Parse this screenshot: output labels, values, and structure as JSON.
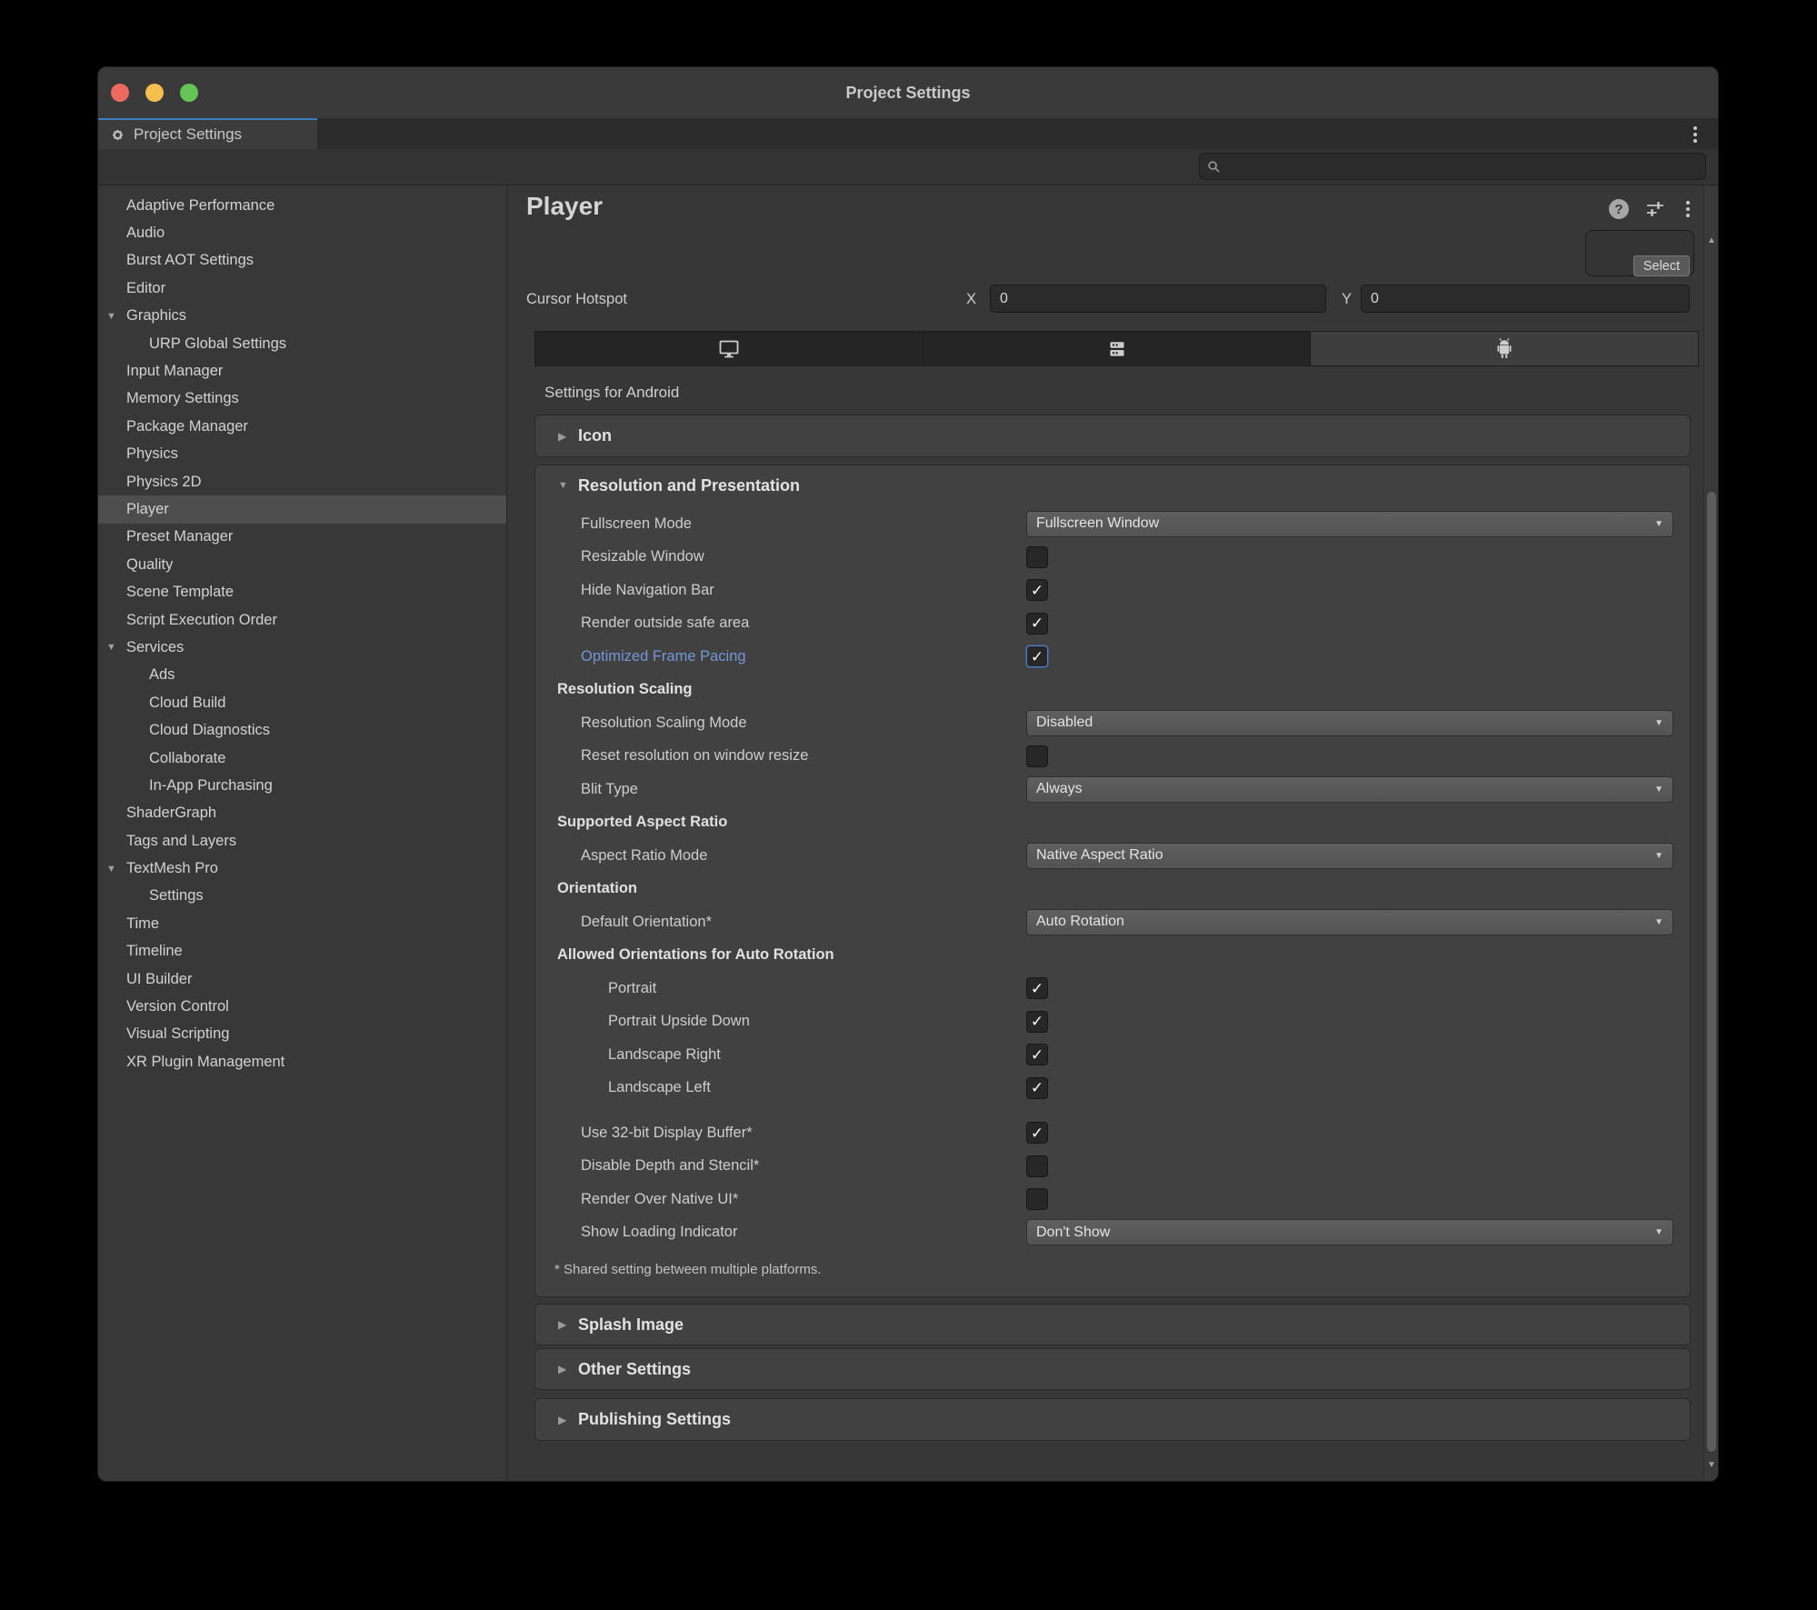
{
  "window": {
    "title": "Project Settings",
    "tab_label": "Project Settings"
  },
  "toolbar": {
    "search_placeholder": ""
  },
  "sidebar": {
    "items": [
      {
        "label": "Adaptive Performance",
        "indent": 0
      },
      {
        "label": "Audio",
        "indent": 0
      },
      {
        "label": "Burst AOT Settings",
        "indent": 0
      },
      {
        "label": "Editor",
        "indent": 0
      },
      {
        "label": "Graphics",
        "indent": 0,
        "expanded": true
      },
      {
        "label": "URP Global Settings",
        "indent": 1
      },
      {
        "label": "Input Manager",
        "indent": 0
      },
      {
        "label": "Memory Settings",
        "indent": 0
      },
      {
        "label": "Package Manager",
        "indent": 0
      },
      {
        "label": "Physics",
        "indent": 0
      },
      {
        "label": "Physics 2D",
        "indent": 0
      },
      {
        "label": "Player",
        "indent": 0,
        "selected": true
      },
      {
        "label": "Preset Manager",
        "indent": 0
      },
      {
        "label": "Quality",
        "indent": 0
      },
      {
        "label": "Scene Template",
        "indent": 0
      },
      {
        "label": "Script Execution Order",
        "indent": 0
      },
      {
        "label": "Services",
        "indent": 0,
        "expanded": true
      },
      {
        "label": "Ads",
        "indent": 1
      },
      {
        "label": "Cloud Build",
        "indent": 1
      },
      {
        "label": "Cloud Diagnostics",
        "indent": 1
      },
      {
        "label": "Collaborate",
        "indent": 1
      },
      {
        "label": "In-App Purchasing",
        "indent": 1
      },
      {
        "label": "ShaderGraph",
        "indent": 0
      },
      {
        "label": "Tags and Layers",
        "indent": 0
      },
      {
        "label": "TextMesh Pro",
        "indent": 0,
        "expanded": true
      },
      {
        "label": "Settings",
        "indent": 1
      },
      {
        "label": "Time",
        "indent": 0
      },
      {
        "label": "Timeline",
        "indent": 0
      },
      {
        "label": "UI Builder",
        "indent": 0
      },
      {
        "label": "Version Control",
        "indent": 0
      },
      {
        "label": "Visual Scripting",
        "indent": 0
      },
      {
        "label": "XR Plugin Management",
        "indent": 0
      }
    ]
  },
  "content": {
    "title": "Player",
    "select_label": "Select",
    "cursor_hotspot": {
      "label": "Cursor Hotspot",
      "x_label": "X",
      "x_value": "0",
      "y_label": "Y",
      "y_value": "0"
    },
    "platform_tabs": [
      {
        "icon": "desktop-icon",
        "selected": false
      },
      {
        "icon": "server-icon",
        "selected": false
      },
      {
        "icon": "android-icon",
        "selected": true
      }
    ],
    "settings_for": "Settings for Android",
    "sections": {
      "icon": "Icon",
      "resolution": "Resolution and Presentation",
      "splash": "Splash Image",
      "other": "Other Settings",
      "publishing": "Publishing Settings"
    },
    "resolution_rows": [
      {
        "type": "dropdown",
        "label": "Fullscreen Mode",
        "value": "Fullscreen Window",
        "indent": 1
      },
      {
        "type": "check",
        "label": "Resizable Window",
        "checked": false,
        "indent": 1
      },
      {
        "type": "check",
        "label": "Hide Navigation Bar",
        "checked": true,
        "indent": 1
      },
      {
        "type": "check",
        "label": "Render outside safe area",
        "checked": true,
        "indent": 1
      },
      {
        "type": "check",
        "label": "Optimized Frame Pacing",
        "checked": true,
        "indent": 1,
        "link": true,
        "focused": true
      },
      {
        "type": "sub",
        "label": "Resolution Scaling"
      },
      {
        "type": "dropdown",
        "label": "Resolution Scaling Mode",
        "value": "Disabled",
        "indent": 1
      },
      {
        "type": "check",
        "label": "Reset resolution on window resize",
        "checked": false,
        "indent": 1
      },
      {
        "type": "dropdown",
        "label": "Blit Type",
        "value": "Always",
        "indent": 1
      },
      {
        "type": "sub",
        "label": "Supported Aspect Ratio"
      },
      {
        "type": "dropdown",
        "label": "Aspect Ratio Mode",
        "value": "Native Aspect Ratio",
        "indent": 1
      },
      {
        "type": "sub",
        "label": "Orientation"
      },
      {
        "type": "dropdown",
        "label": "Default Orientation*",
        "value": "Auto Rotation",
        "indent": 1
      },
      {
        "type": "sub",
        "label": "Allowed Orientations for Auto Rotation"
      },
      {
        "type": "check",
        "label": "Portrait",
        "checked": true,
        "indent": 2
      },
      {
        "type": "check",
        "label": "Portrait Upside Down",
        "checked": true,
        "indent": 2
      },
      {
        "type": "check",
        "label": "Landscape Right",
        "checked": true,
        "indent": 2
      },
      {
        "type": "check",
        "label": "Landscape Left",
        "checked": true,
        "indent": 2
      },
      {
        "type": "gap"
      },
      {
        "type": "check",
        "label": "Use 32-bit Display Buffer*",
        "checked": true,
        "indent": 1
      },
      {
        "type": "check",
        "label": "Disable Depth and Stencil*",
        "checked": false,
        "indent": 1
      },
      {
        "type": "check",
        "label": "Render Over Native UI*",
        "checked": false,
        "indent": 1
      },
      {
        "type": "dropdown",
        "label": "Show Loading Indicator",
        "value": "Don't Show",
        "indent": 1
      }
    ],
    "footnote": "* Shared setting between multiple platforms."
  },
  "colors": {
    "accent_blue": "#3e7cc2",
    "link_blue": "#7396d5",
    "traffic_red": "#ed6a5f",
    "traffic_yellow": "#f5bf4f",
    "traffic_green": "#62c554"
  }
}
